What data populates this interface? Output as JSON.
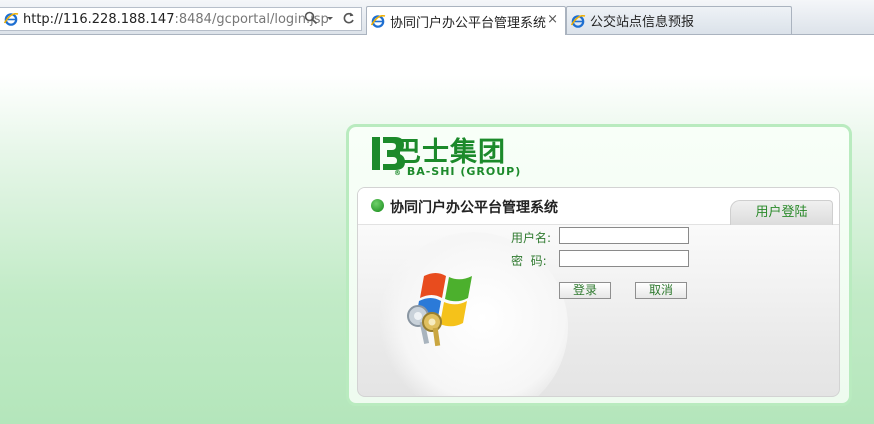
{
  "browser": {
    "url_host": "http://116.228.188.147",
    "url_rest": ":8484/gcportal/login.jsp",
    "search_icon": "search-icon",
    "refresh_icon": "refresh-icon",
    "tabs": [
      {
        "title": "协同门户办公平台管理系统",
        "active": true,
        "close": "×"
      },
      {
        "title": "公交站点信息预报",
        "active": false
      }
    ]
  },
  "page": {
    "logo": {
      "cn": "巴士集团",
      "en": "BA-SHI (GROUP)",
      "reg": "®"
    },
    "system_title": "协同门户办公平台管理系统",
    "login_tab": "用户登陆",
    "form": {
      "username_label": "用户名:",
      "username_value": "",
      "password_label": "密  码:",
      "password_value": "",
      "login_button": "登录",
      "cancel_button": "取消"
    }
  },
  "colors": {
    "brand_green": "#1c8a2b",
    "label_green": "#2f7a2f"
  }
}
